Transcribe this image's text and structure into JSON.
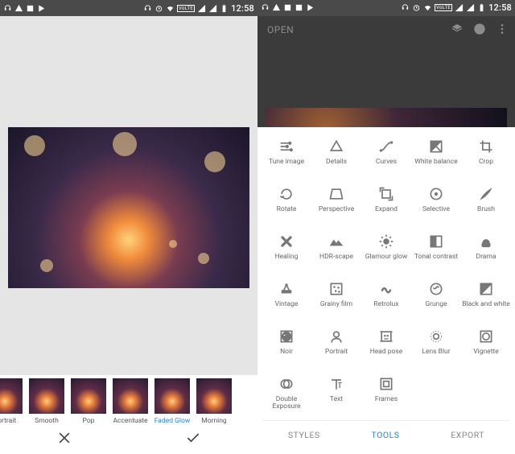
{
  "statusbar": {
    "time": "12:58",
    "volte": "VoLTE"
  },
  "left": {
    "filters": [
      {
        "label": "Portrait"
      },
      {
        "label": "Smooth"
      },
      {
        "label": "Pop"
      },
      {
        "label": "Accentuate"
      },
      {
        "label": "Faded Glow",
        "selected": true
      },
      {
        "label": "Morning"
      }
    ]
  },
  "right": {
    "open_label": "OPEN",
    "tabs": {
      "styles": "STYLES",
      "tools": "TOOLS",
      "export": "EXPORT"
    },
    "tools": [
      {
        "label": "Tune image",
        "icon": "sliders"
      },
      {
        "label": "Details",
        "icon": "details"
      },
      {
        "label": "Curves",
        "icon": "curves"
      },
      {
        "label": "White balance",
        "icon": "whitebalance"
      },
      {
        "label": "Crop",
        "icon": "crop"
      },
      {
        "label": "Rotate",
        "icon": "rotate"
      },
      {
        "label": "Perspective",
        "icon": "perspective"
      },
      {
        "label": "Expand",
        "icon": "expand"
      },
      {
        "label": "Selective",
        "icon": "selective"
      },
      {
        "label": "Brush",
        "icon": "brush"
      },
      {
        "label": "Healing",
        "icon": "healing"
      },
      {
        "label": "HDR-scape",
        "icon": "hdr"
      },
      {
        "label": "Glamour glow",
        "icon": "glow"
      },
      {
        "label": "Tonal contrast",
        "icon": "tonal"
      },
      {
        "label": "Drama",
        "icon": "drama"
      },
      {
        "label": "Vintage",
        "icon": "vintage"
      },
      {
        "label": "Grainy film",
        "icon": "grainy"
      },
      {
        "label": "Retrolux",
        "icon": "retrolux"
      },
      {
        "label": "Grunge",
        "icon": "grunge"
      },
      {
        "label": "Black and white",
        "icon": "bw"
      },
      {
        "label": "Noir",
        "icon": "noir"
      },
      {
        "label": "Portrait",
        "icon": "portrait"
      },
      {
        "label": "Head pose",
        "icon": "headpose"
      },
      {
        "label": "Lens Blur",
        "icon": "lensblur"
      },
      {
        "label": "Vignette",
        "icon": "vignette"
      },
      {
        "label": "Double Exposure",
        "icon": "double"
      },
      {
        "label": "Text",
        "icon": "text"
      },
      {
        "label": "Frames",
        "icon": "frames"
      }
    ]
  }
}
